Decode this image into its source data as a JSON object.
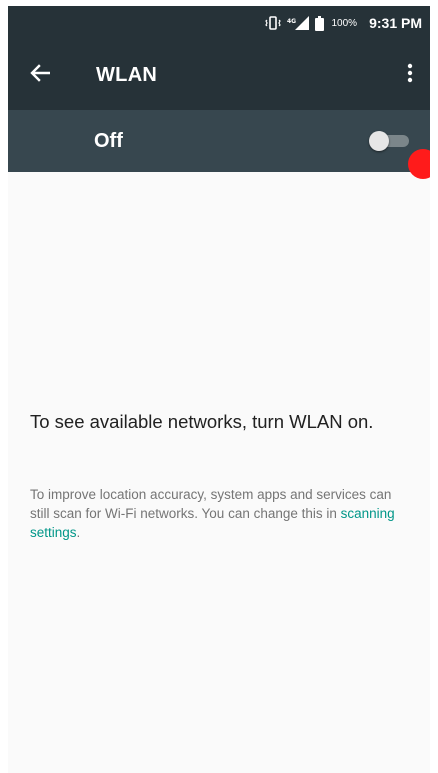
{
  "status_bar": {
    "battery_percent": "100%",
    "time": "9:31 PM",
    "icons": [
      "vibrate-icon",
      "mobile-signal-icon",
      "battery-icon"
    ]
  },
  "app_bar": {
    "title": "WLAN",
    "back_icon": "arrow-back-icon",
    "overflow_icon": "more-vert-icon"
  },
  "master_switch": {
    "label": "Off",
    "state": "off"
  },
  "empty_state": {
    "message": "To see available networks, turn WLAN on.",
    "hint_prefix": "To improve location accuracy, system apps and services can still scan for Wi-Fi networks. You can change this in ",
    "hint_link": "scanning settings",
    "hint_suffix": "."
  },
  "colors": {
    "app_bar": "#263238",
    "switch_bar": "#37474f",
    "link": "#009688",
    "touch_indicator": "#ff1b1b"
  }
}
